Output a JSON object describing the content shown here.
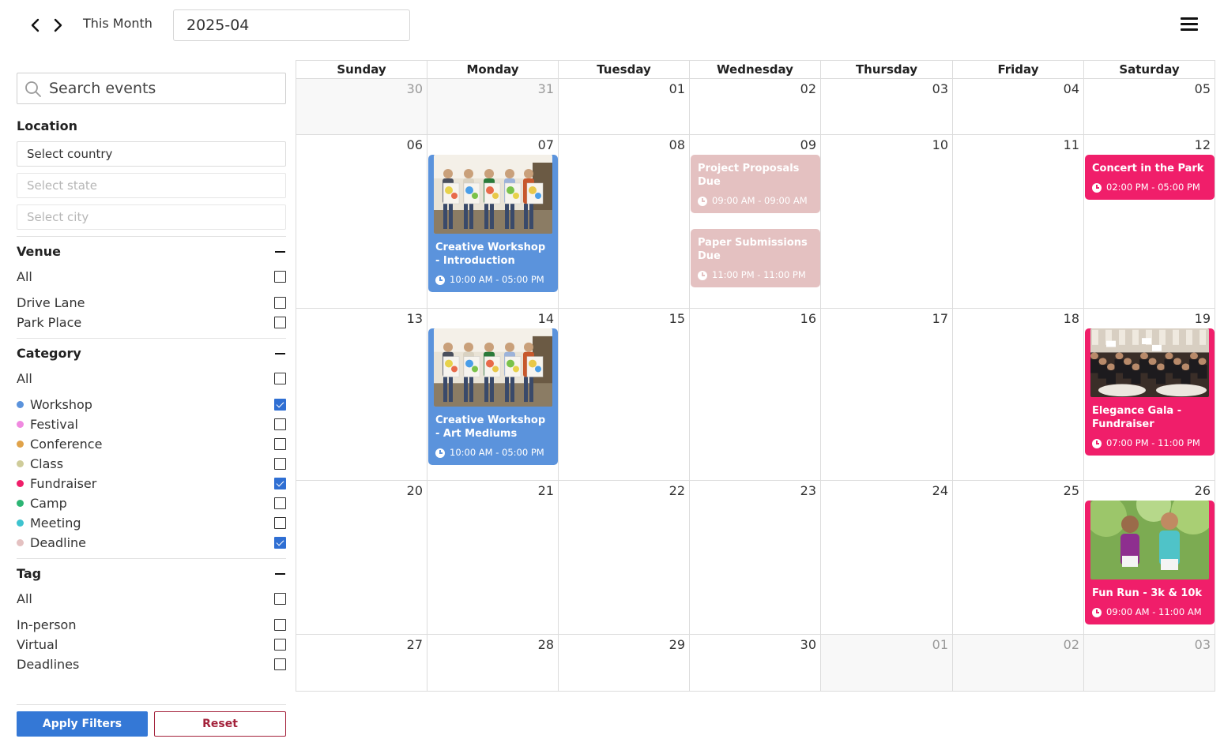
{
  "header": {
    "prev_icon": "chevron-left-icon",
    "next_icon": "chevron-right-icon",
    "this_month_label": "This Month",
    "month_value": "2025-04",
    "menu_icon": "hamburger-menu-icon"
  },
  "sidebar": {
    "search_placeholder": "Search events",
    "location": {
      "title": "Location",
      "country_placeholder": "Select country",
      "state_placeholder": "Select state",
      "city_placeholder": "Select city"
    },
    "venue": {
      "title": "Venue",
      "all_label": "All",
      "items": [
        {
          "label": "Drive Lane",
          "checked": false
        },
        {
          "label": "Park Place",
          "checked": false
        }
      ]
    },
    "category": {
      "title": "Category",
      "all_label": "All",
      "items": [
        {
          "label": "Workshop",
          "color": "#5b93dc",
          "checked": true
        },
        {
          "label": "Festival",
          "color": "#f08ae0",
          "checked": false
        },
        {
          "label": "Conference",
          "color": "#e0a34a",
          "checked": false
        },
        {
          "label": "Class",
          "color": "#cfcc9a",
          "checked": false
        },
        {
          "label": "Fundraiser",
          "color": "#f01e6a",
          "checked": true
        },
        {
          "label": "Camp",
          "color": "#2cb574",
          "checked": false
        },
        {
          "label": "Meeting",
          "color": "#3ec3cf",
          "checked": false
        },
        {
          "label": "Deadline",
          "color": "#e4c1c1",
          "checked": true
        }
      ]
    },
    "tag": {
      "title": "Tag",
      "all_label": "All",
      "items": [
        {
          "label": "In-person",
          "checked": false
        },
        {
          "label": "Virtual",
          "checked": false
        },
        {
          "label": "Deadlines",
          "checked": false
        }
      ]
    },
    "apply_label": "Apply Filters",
    "reset_label": "Reset"
  },
  "calendar": {
    "weekdays": [
      "Sunday",
      "Monday",
      "Tuesday",
      "Wednesday",
      "Thursday",
      "Friday",
      "Saturday"
    ],
    "weeks": [
      [
        {
          "day": "30",
          "other": true
        },
        {
          "day": "31",
          "other": true
        },
        {
          "day": "01"
        },
        {
          "day": "02"
        },
        {
          "day": "03"
        },
        {
          "day": "04"
        },
        {
          "day": "05"
        }
      ],
      [
        {
          "day": "06"
        },
        {
          "day": "07"
        },
        {
          "day": "08"
        },
        {
          "day": "09"
        },
        {
          "day": "10"
        },
        {
          "day": "11"
        },
        {
          "day": "12"
        }
      ],
      [
        {
          "day": "13"
        },
        {
          "day": "14"
        },
        {
          "day": "15"
        },
        {
          "day": "16"
        },
        {
          "day": "17"
        },
        {
          "day": "18"
        },
        {
          "day": "19"
        }
      ],
      [
        {
          "day": "20"
        },
        {
          "day": "21"
        },
        {
          "day": "22"
        },
        {
          "day": "23"
        },
        {
          "day": "24"
        },
        {
          "day": "25"
        },
        {
          "day": "26"
        }
      ],
      [
        {
          "day": "27"
        },
        {
          "day": "28"
        },
        {
          "day": "29"
        },
        {
          "day": "30"
        },
        {
          "day": "01",
          "other": true
        },
        {
          "day": "02",
          "other": true
        },
        {
          "day": "03",
          "other": true
        }
      ]
    ],
    "events": [
      {
        "week": 1,
        "col": 1,
        "title": "Creative Workshop - Introduction",
        "time": "10:00 AM - 05:00 PM",
        "color": "blue",
        "image": "workshop-photo"
      },
      {
        "week": 1,
        "col": 3,
        "title": "Project Proposals Due",
        "time": "09:00 AM - 09:00 AM",
        "color": "rose"
      },
      {
        "week": 1,
        "col": 3,
        "title": "Paper Submissions Due",
        "time": "11:00 PM - 11:00 PM",
        "color": "rose"
      },
      {
        "week": 1,
        "col": 6,
        "title": "Concert in the Park",
        "time": "02:00 PM - 05:00 PM",
        "color": "pink"
      },
      {
        "week": 2,
        "col": 1,
        "title": "Creative Workshop - Art Mediums",
        "time": "10:00 AM - 05:00 PM",
        "color": "blue",
        "image": "workshop-photo"
      },
      {
        "week": 2,
        "col": 6,
        "title": "Elegance Gala - Fundraiser",
        "time": "07:00 PM - 11:00 PM",
        "color": "pink",
        "image": "gala-photo"
      },
      {
        "week": 3,
        "col": 6,
        "title": "Fun Run - 3k & 10k",
        "time": "09:00 AM - 11:00 AM",
        "color": "pink",
        "image": "run-photo"
      }
    ]
  }
}
